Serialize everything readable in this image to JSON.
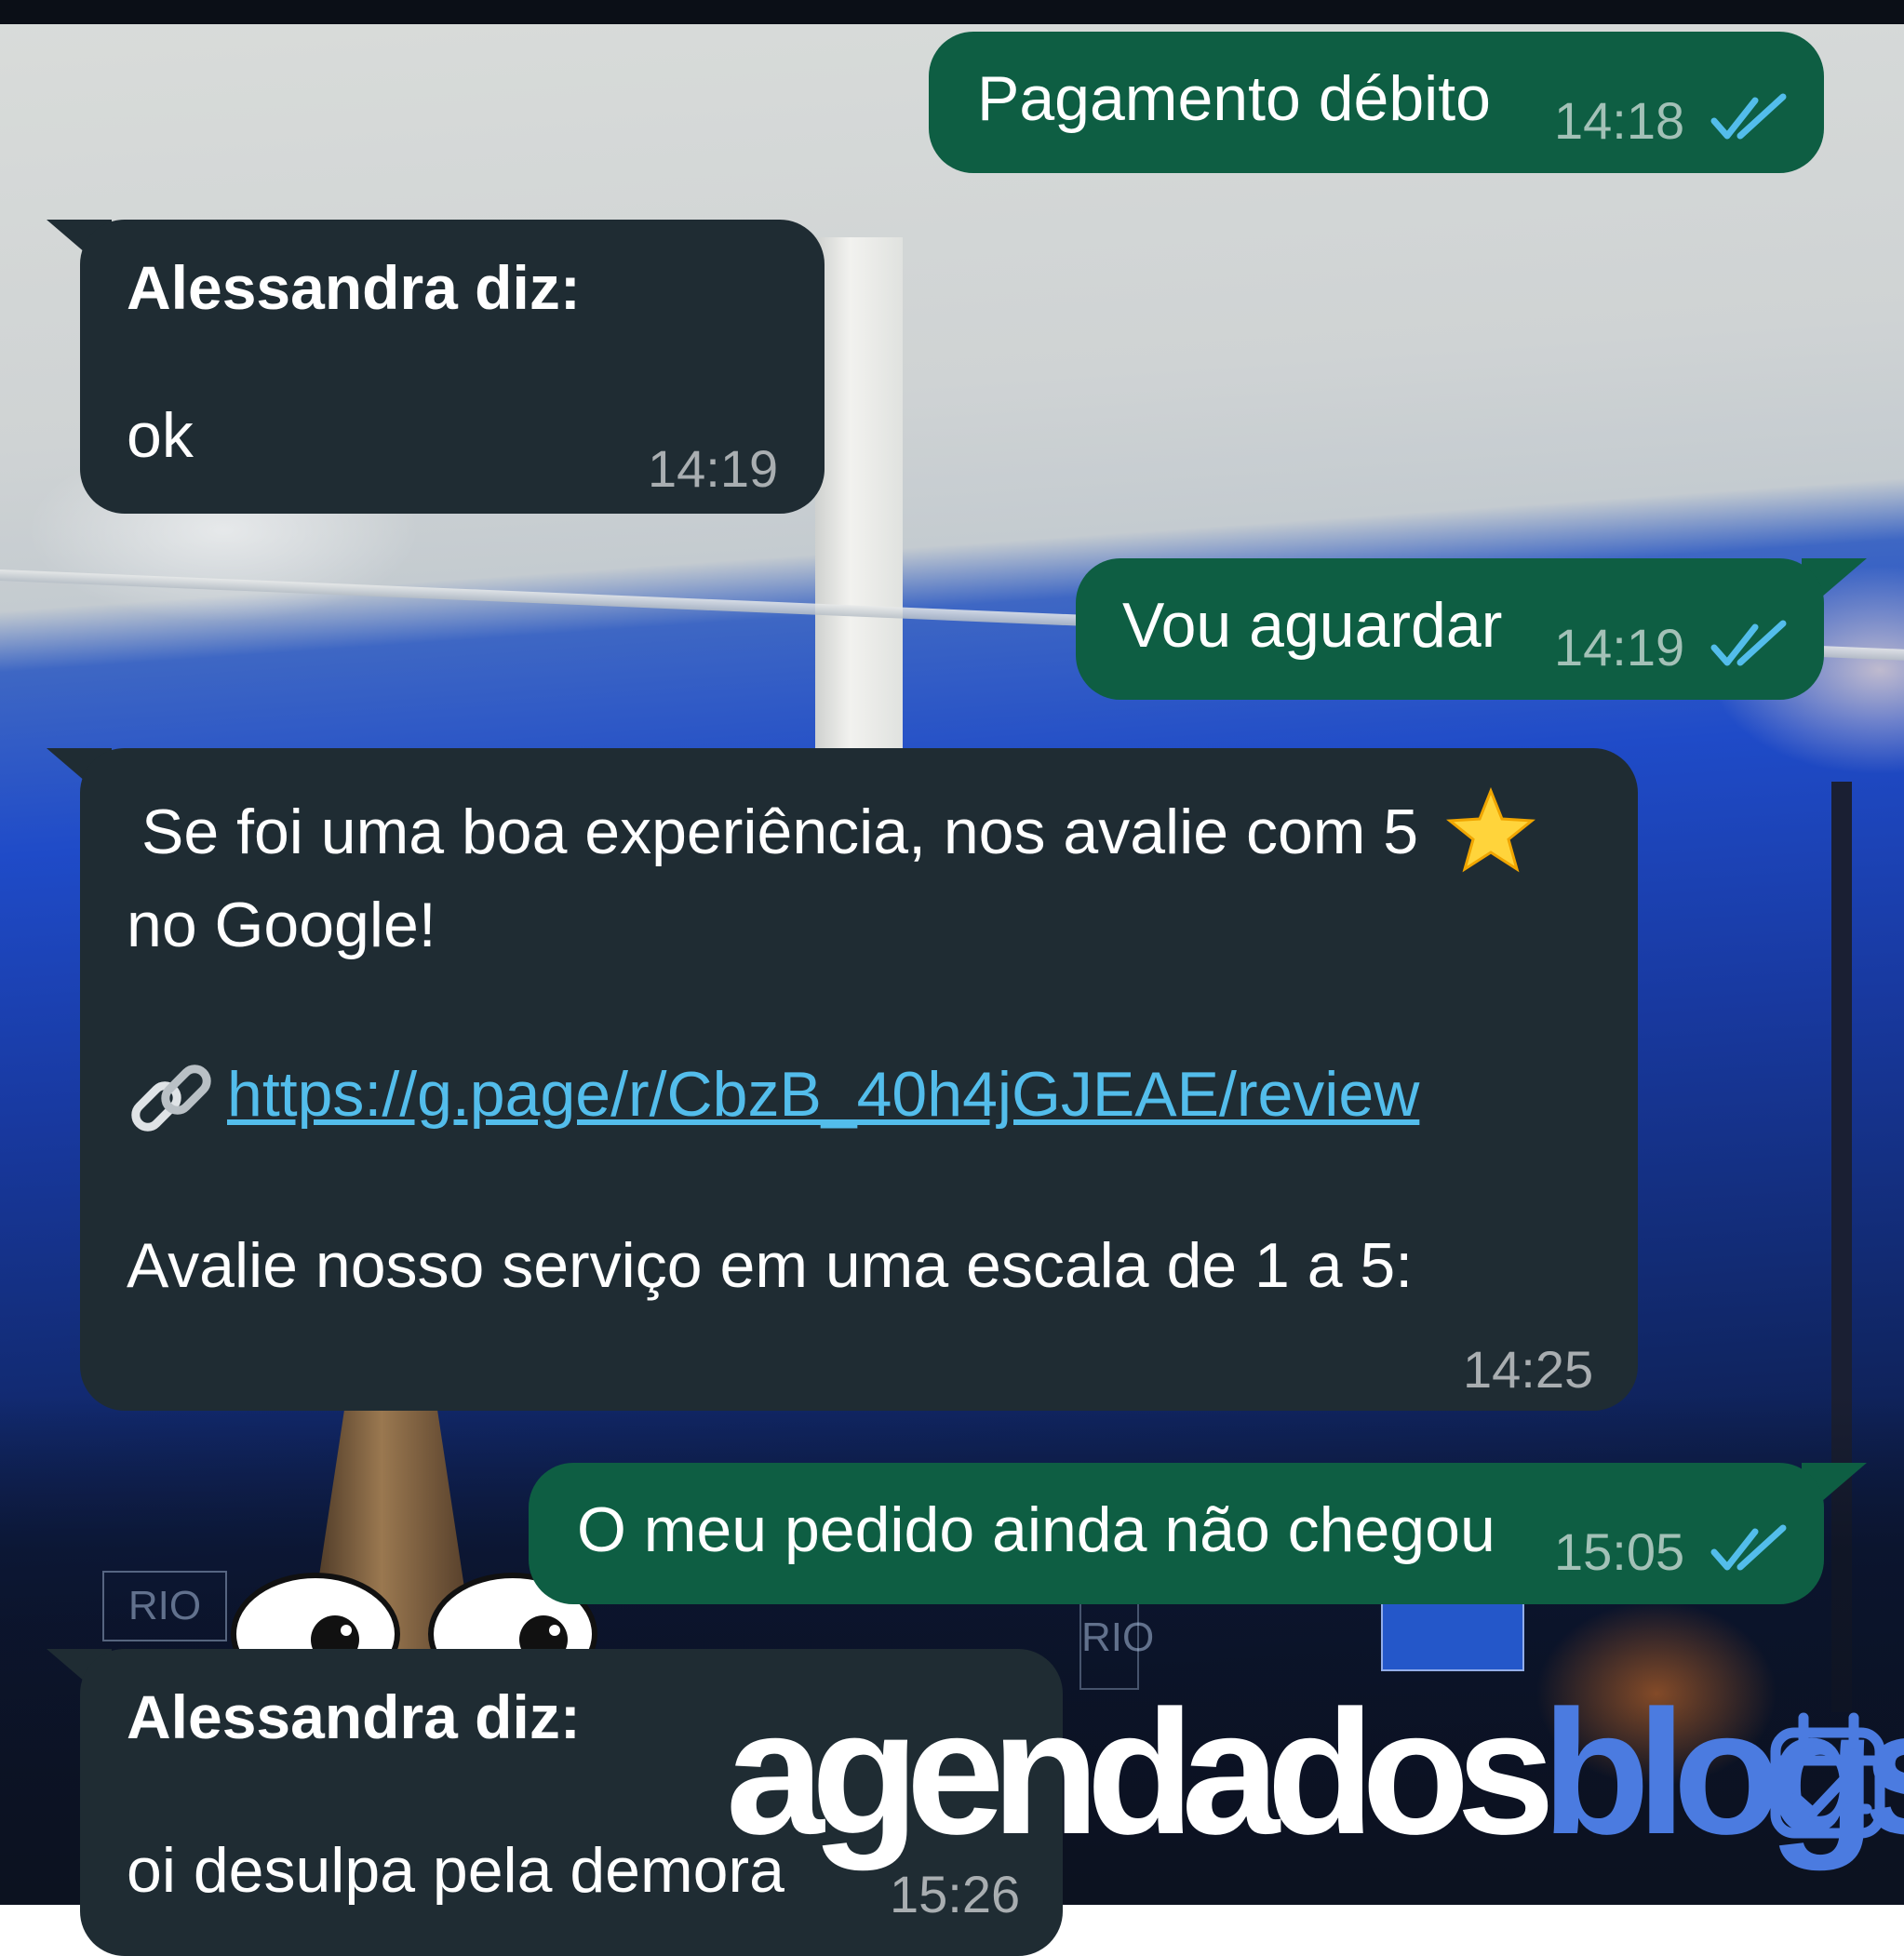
{
  "messages": [
    {
      "direction": "outgoing",
      "text": "Pagamento débito",
      "time": "14:18",
      "status": "read"
    },
    {
      "direction": "incoming",
      "sender": "Alessandra diz:",
      "text": "ok",
      "time": "14:19"
    },
    {
      "direction": "outgoing",
      "text": "Vou aguardar",
      "time": "14:19",
      "status": "read"
    },
    {
      "direction": "incoming",
      "line1": "Se foi uma boa experiência, nos avalie com 5",
      "line2": "no Google!",
      "link": "https://g.page/r/CbzB_40h4jGJEAE/review",
      "line3": "Avalie nosso serviço em uma escala de 1 a 5:",
      "time": "14:25"
    },
    {
      "direction": "outgoing",
      "text": "O meu pedido ainda não chegou",
      "time": "15:05",
      "status": "read"
    },
    {
      "direction": "incoming",
      "sender": "Alessandra diz:",
      "text": "oi desulpa pela demora",
      "time": "15:26"
    }
  ],
  "icons": {
    "read_receipt": "double-check-icon",
    "star": "star-icon",
    "link": "chain-link-icon",
    "calendar": "calendar-check-icon"
  },
  "colors": {
    "outgoing_bubble": "#0e5e43",
    "incoming_bubble": "#1f2c33",
    "read_tick": "#53bdeb",
    "link": "#53bdeb"
  },
  "background_signs": {
    "rio_left": "RIO",
    "rio_right": "RIO"
  },
  "watermark": {
    "part1": "agendados",
    "part2": "blogs"
  }
}
